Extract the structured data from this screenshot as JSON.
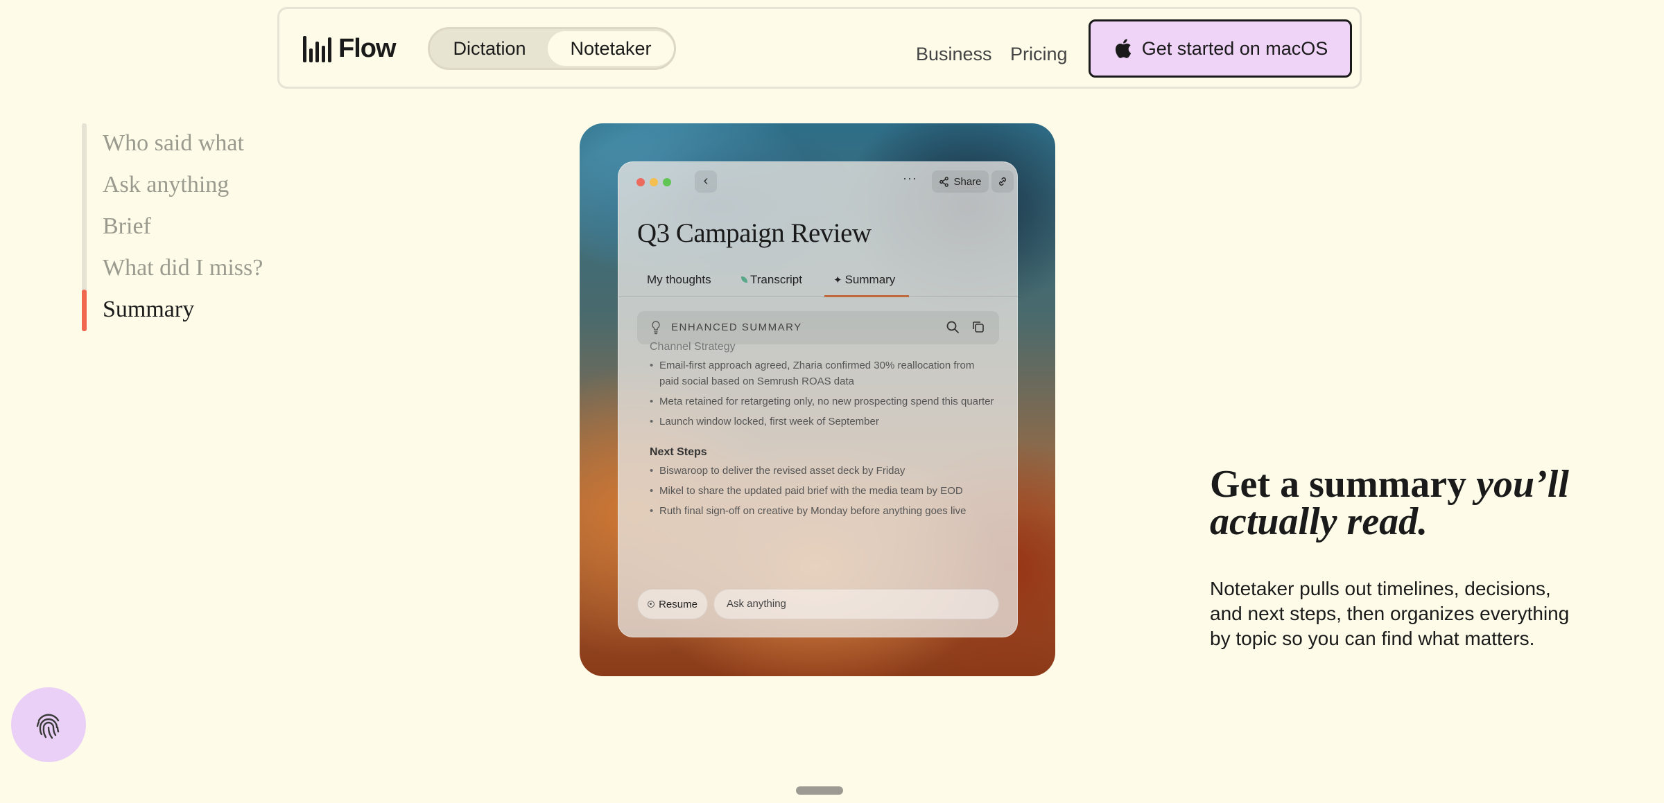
{
  "nav": {
    "logo_text": "Flow",
    "segments": [
      "Dictation",
      "Notetaker"
    ],
    "links": [
      "Business",
      "Pricing"
    ],
    "cta_label": "Get started on macOS",
    "cta_color": "#efd4f7"
  },
  "side_nav": {
    "items": [
      "Who said what",
      "Ask anything",
      "Brief",
      "What did I miss?",
      "Summary"
    ],
    "active_index": 4,
    "accent_color": "#f0664e"
  },
  "note_window": {
    "title": "Q3 Campaign Review",
    "share_label": "Share",
    "tabs": [
      "My thoughts",
      "Transcript",
      "Summary"
    ],
    "active_tab": "Summary",
    "summary_bar_label": "ENHANCED SUMMARY",
    "sections": [
      {
        "heading": "Channel Strategy",
        "bullets": [
          "Email-first approach agreed, Zharia confirmed 30% reallocation from paid social based on Semrush ROAS data",
          "Meta retained for retargeting only, no new prospecting spend this quarter",
          "Launch window locked, first week of September"
        ]
      },
      {
        "heading": "Next Steps",
        "bullets": [
          "Biswaroop to deliver the revised asset deck by Friday",
          "Mikel to share the updated paid brief with the media team by EOD",
          "Ruth final sign-off on creative by Monday before anything goes live"
        ]
      }
    ],
    "resume_label": "Resume",
    "ask_placeholder": "Ask anything"
  },
  "hero_copy": {
    "headline_plain": "Get a summary ",
    "headline_italic": "you’ll actually read.",
    "body": "Notetaker pulls out timelines, decisions, and next steps, then organizes everything by topic so you can find what matters."
  },
  "icons": {
    "logo": "waveform-bars-icon",
    "cta": "apple-icon",
    "fab": "fingerprint-icon"
  }
}
